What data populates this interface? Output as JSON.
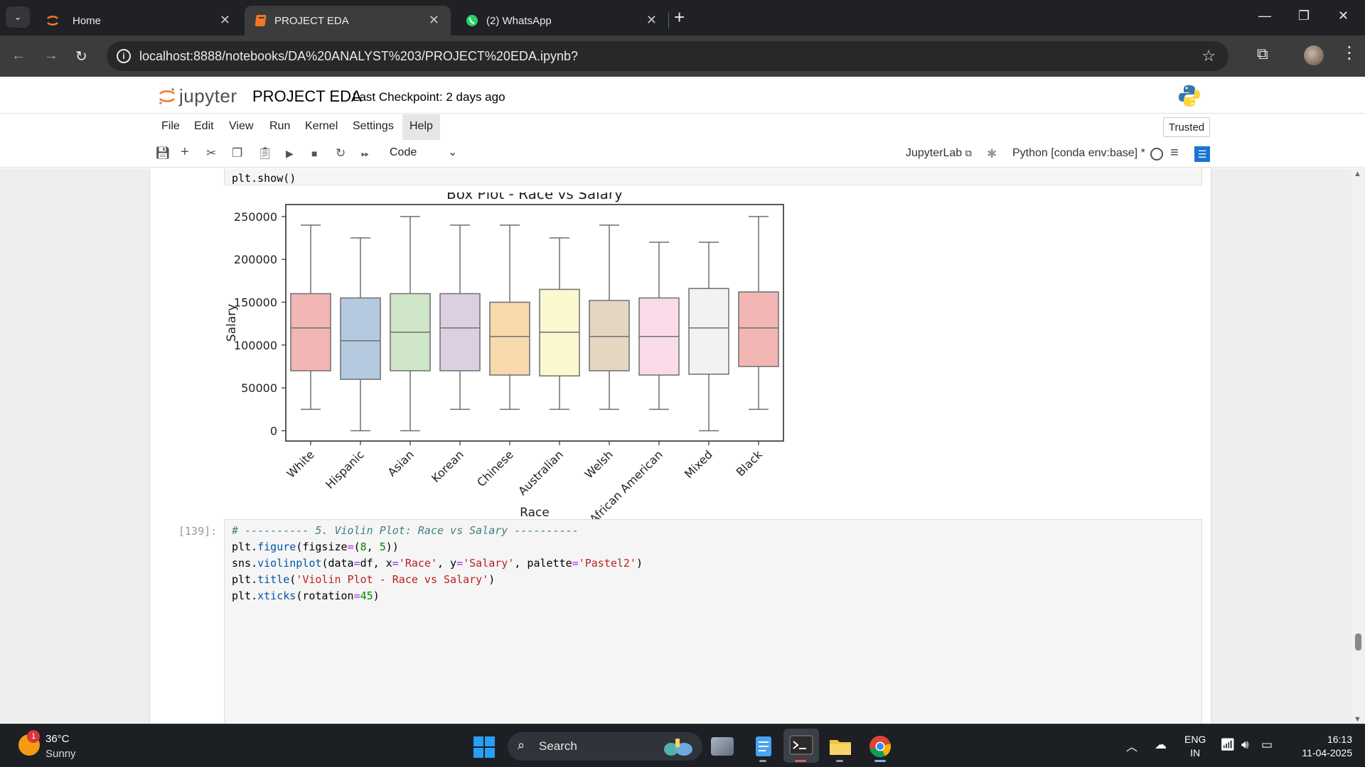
{
  "browser": {
    "tabs": [
      {
        "title": "Home",
        "active": false
      },
      {
        "title": "PROJECT EDA",
        "active": true
      },
      {
        "title": "(2) WhatsApp",
        "active": false
      }
    ],
    "url": "localhost:8888/notebooks/DA%20ANALYST%203/PROJECT%20EDA.ipynb?"
  },
  "jupyter": {
    "logo_text": "jupyter",
    "notebook_title": "PROJECT EDA",
    "checkpoint": "Last Checkpoint: 2 days ago",
    "menu": [
      "File",
      "Edit",
      "View",
      "Run",
      "Kernel",
      "Settings",
      "Help"
    ],
    "trusted": "Trusted",
    "cell_type": "Code",
    "jupyterlab_link": "JupyterLab",
    "kernel": "Python [conda env:base] *"
  },
  "cells": {
    "prev_tail": "plt.show()",
    "next": {
      "prompt": "[139]:",
      "lines": [
        "# ---------- 5. Violin Plot: Race vs Salary ----------",
        "plt.figure(figsize=(8, 5))",
        "sns.violinplot(data=df, x='Race', y='Salary', palette='Pastel2')",
        "plt.title('Violin Plot - Race vs Salary')",
        "plt.xticks(rotation=45)"
      ]
    }
  },
  "chart_data": {
    "type": "box",
    "title": "Box Plot - Race vs Salary",
    "xlabel": "Race",
    "ylabel": "Salary",
    "ylim": [
      -12000,
      264000
    ],
    "yticks": [
      0,
      50000,
      100000,
      150000,
      200000,
      250000
    ],
    "ytick_labels": [
      "0",
      "50000",
      "100000",
      "150000",
      "200000",
      "250000"
    ],
    "categories": [
      "White",
      "Hispanic",
      "Asian",
      "Korean",
      "Chinese",
      "Australian",
      "Welsh",
      "African American",
      "Mixed",
      "Black"
    ],
    "boxes": [
      {
        "min": 25000,
        "q1": 70000,
        "median": 120000,
        "q3": 160000,
        "max": 240000,
        "color": "#f2b6b5"
      },
      {
        "min": 0,
        "q1": 60000,
        "median": 105000,
        "q3": 155000,
        "max": 225000,
        "color": "#b5cadf"
      },
      {
        "min": 0,
        "q1": 70000,
        "median": 115000,
        "q3": 160000,
        "max": 250000,
        "color": "#cfe6c8"
      },
      {
        "min": 25000,
        "q1": 70000,
        "median": 120000,
        "q3": 160000,
        "max": 240000,
        "color": "#dccfe2"
      },
      {
        "min": 25000,
        "q1": 65000,
        "median": 110000,
        "q3": 150000,
        "max": 240000,
        "color": "#f8d8ad"
      },
      {
        "min": 25000,
        "q1": 64000,
        "median": 115000,
        "q3": 165000,
        "max": 225000,
        "color": "#f9f8cf"
      },
      {
        "min": 25000,
        "q1": 70000,
        "median": 110000,
        "q3": 152000,
        "max": 240000,
        "color": "#e4d7c1"
      },
      {
        "min": 25000,
        "q1": 65000,
        "median": 110000,
        "q3": 155000,
        "max": 220000,
        "color": "#f9dbe9"
      },
      {
        "min": 0,
        "q1": 66000,
        "median": 120000,
        "q3": 166000,
        "max": 220000,
        "color": "#f2f2f2"
      },
      {
        "min": 25000,
        "q1": 75000,
        "median": 120000,
        "q3": 162000,
        "max": 250000,
        "color": "#f2b6b5"
      }
    ]
  },
  "taskbar": {
    "weather_temp": "36°C",
    "weather_desc": "Sunny",
    "weather_badge": "1",
    "search": "Search",
    "lang_top": "ENG",
    "lang_bottom": "IN",
    "time": "16:13",
    "date": "11-04-2025"
  },
  "colors": {
    "jupyter_orange": "#f37626",
    "kernel_accent": "#1976d2"
  }
}
